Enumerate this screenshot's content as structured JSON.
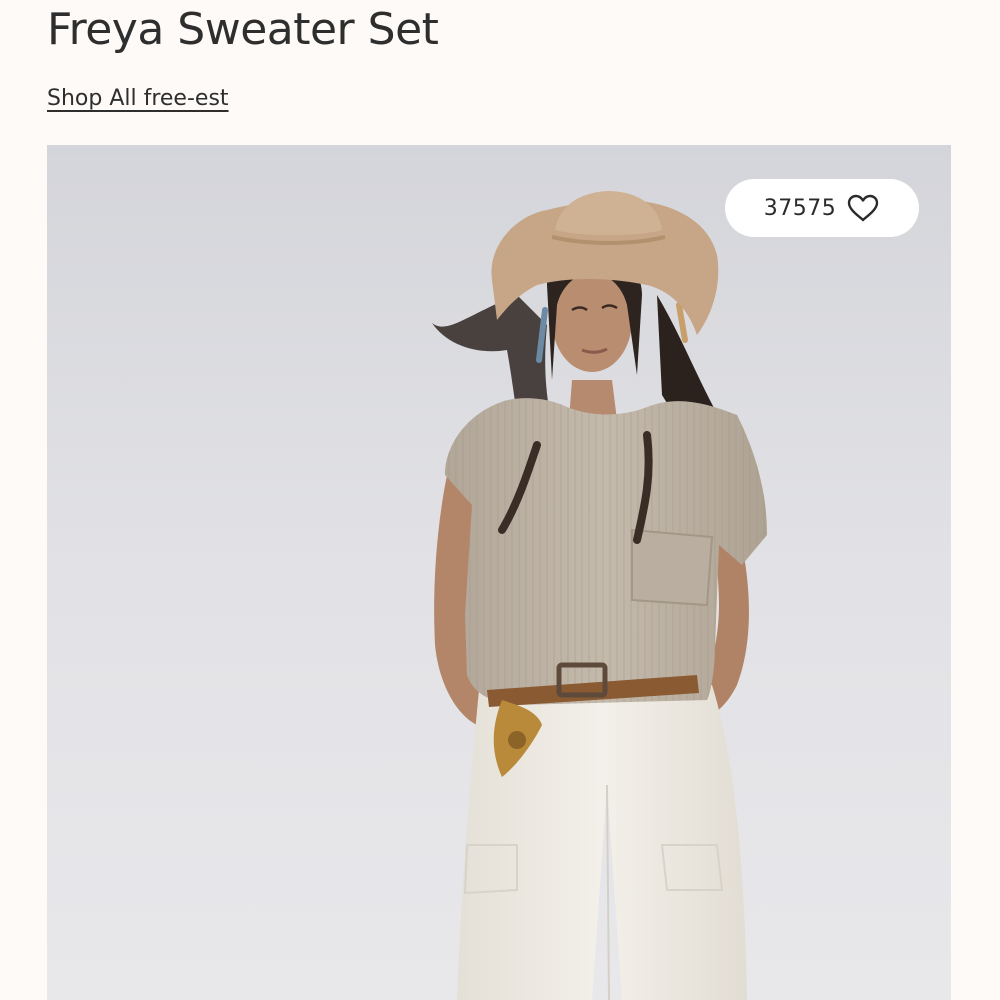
{
  "product": {
    "title": "Freya Sweater Set",
    "shop_link_label": "Shop All free-est"
  },
  "gallery": {
    "like_count": "37575",
    "like_icon": "heart-outline-icon"
  },
  "colors": {
    "background": "#fdfaf8",
    "text": "#2e2e2e",
    "photo_backdrop": "#e3e3e7",
    "hat": "#c7a98a",
    "sweater": "#bdb2a4",
    "pants": "#efebe3",
    "belt": "#8a5a33"
  }
}
